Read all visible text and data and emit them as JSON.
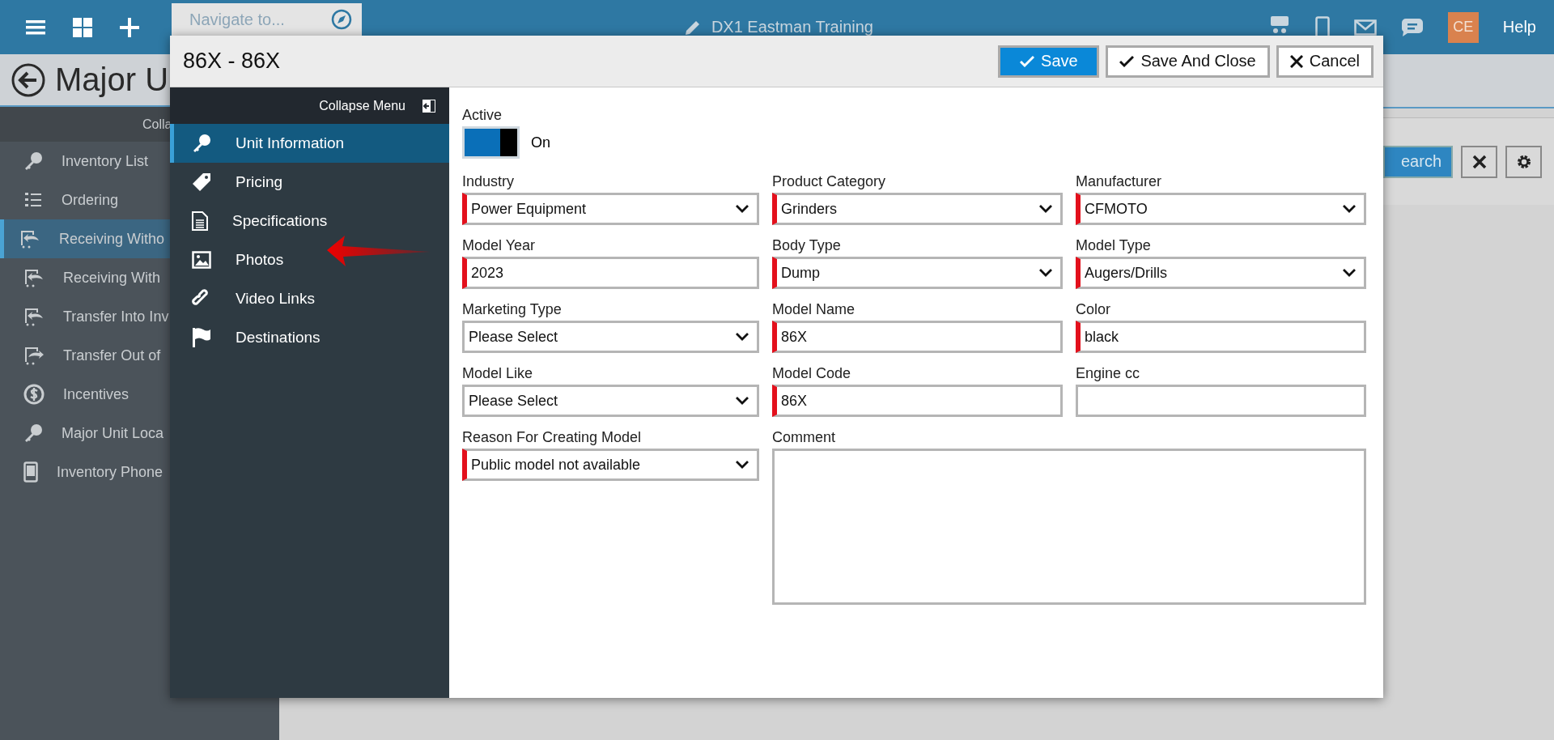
{
  "top_bar": {
    "navigate_placeholder": "Navigate to...",
    "title": "DX1 Eastman Training",
    "avatar": "CE",
    "help": "Help"
  },
  "page": {
    "title": "Major U",
    "sidebar_header": "Colla",
    "search_button": "earch"
  },
  "sidebar": {
    "items": [
      {
        "label": "Inventory List",
        "kind": "key",
        "selected": false
      },
      {
        "label": "Ordering",
        "kind": "list",
        "selected": false
      },
      {
        "label": "Receiving Witho",
        "kind": "receive",
        "selected": true
      },
      {
        "label": "Receiving With",
        "kind": "receive",
        "selected": false
      },
      {
        "label": "Transfer Into Inv",
        "kind": "receive",
        "selected": false
      },
      {
        "label": "Transfer Out of",
        "kind": "send",
        "selected": false
      },
      {
        "label": "Incentives",
        "kind": "dollar",
        "selected": false
      },
      {
        "label": "Major Unit Loca",
        "kind": "key",
        "selected": false
      },
      {
        "label": "Inventory Phone",
        "kind": "phone",
        "selected": false
      }
    ]
  },
  "dialog": {
    "title": "86X - 86X",
    "buttons": [
      {
        "label": "Save",
        "kind": "primary"
      },
      {
        "label": "Save And Close",
        "kind": "check"
      },
      {
        "label": "Cancel",
        "kind": "cancel"
      }
    ],
    "menu": {
      "collapse_label": "Collapse Menu",
      "items": [
        {
          "label": "Unit Information",
          "kind": "key",
          "selected": true
        },
        {
          "label": "Pricing",
          "kind": "tag",
          "selected": false
        },
        {
          "label": "Specifications",
          "kind": "document",
          "selected": false
        },
        {
          "label": "Photos",
          "kind": "image",
          "selected": false
        },
        {
          "label": "Video Links",
          "kind": "link",
          "selected": false
        },
        {
          "label": "Destinations",
          "kind": "flag",
          "selected": false
        }
      ]
    },
    "active": {
      "label": "Active",
      "on": true,
      "state_text": "On"
    },
    "fields": [
      {
        "label": "Industry",
        "kind": "select",
        "value": "Power Equipment",
        "required": true
      },
      {
        "label": "Product Category",
        "kind": "select",
        "value": "Grinders",
        "required": true
      },
      {
        "label": "Manufacturer",
        "kind": "select",
        "value": "CFMOTO",
        "required": true
      },
      {
        "label": "Model Year",
        "kind": "text",
        "value": "2023",
        "required": true
      },
      {
        "label": "Body Type",
        "kind": "select",
        "value": "Dump",
        "required": true
      },
      {
        "label": "Model Type",
        "kind": "select",
        "value": "Augers/Drills",
        "required": true
      },
      {
        "label": "Marketing Type",
        "kind": "select",
        "value": "Please Select",
        "required": false
      },
      {
        "label": "Model Name",
        "kind": "text",
        "value": "86X",
        "required": true
      },
      {
        "label": "Color",
        "kind": "text",
        "value": "black",
        "required": true
      },
      {
        "label": "Model Like",
        "kind": "select",
        "value": "Please Select",
        "required": false
      },
      {
        "label": "Model Code",
        "kind": "text",
        "value": "86X",
        "required": true
      },
      {
        "label": "Engine cc",
        "kind": "text",
        "required": false
      },
      {
        "label": "Reason For Creating Model",
        "kind": "select",
        "value": "Public model not available",
        "required": true
      },
      {
        "label": "Comment",
        "kind": "textarea",
        "required": false
      }
    ]
  }
}
